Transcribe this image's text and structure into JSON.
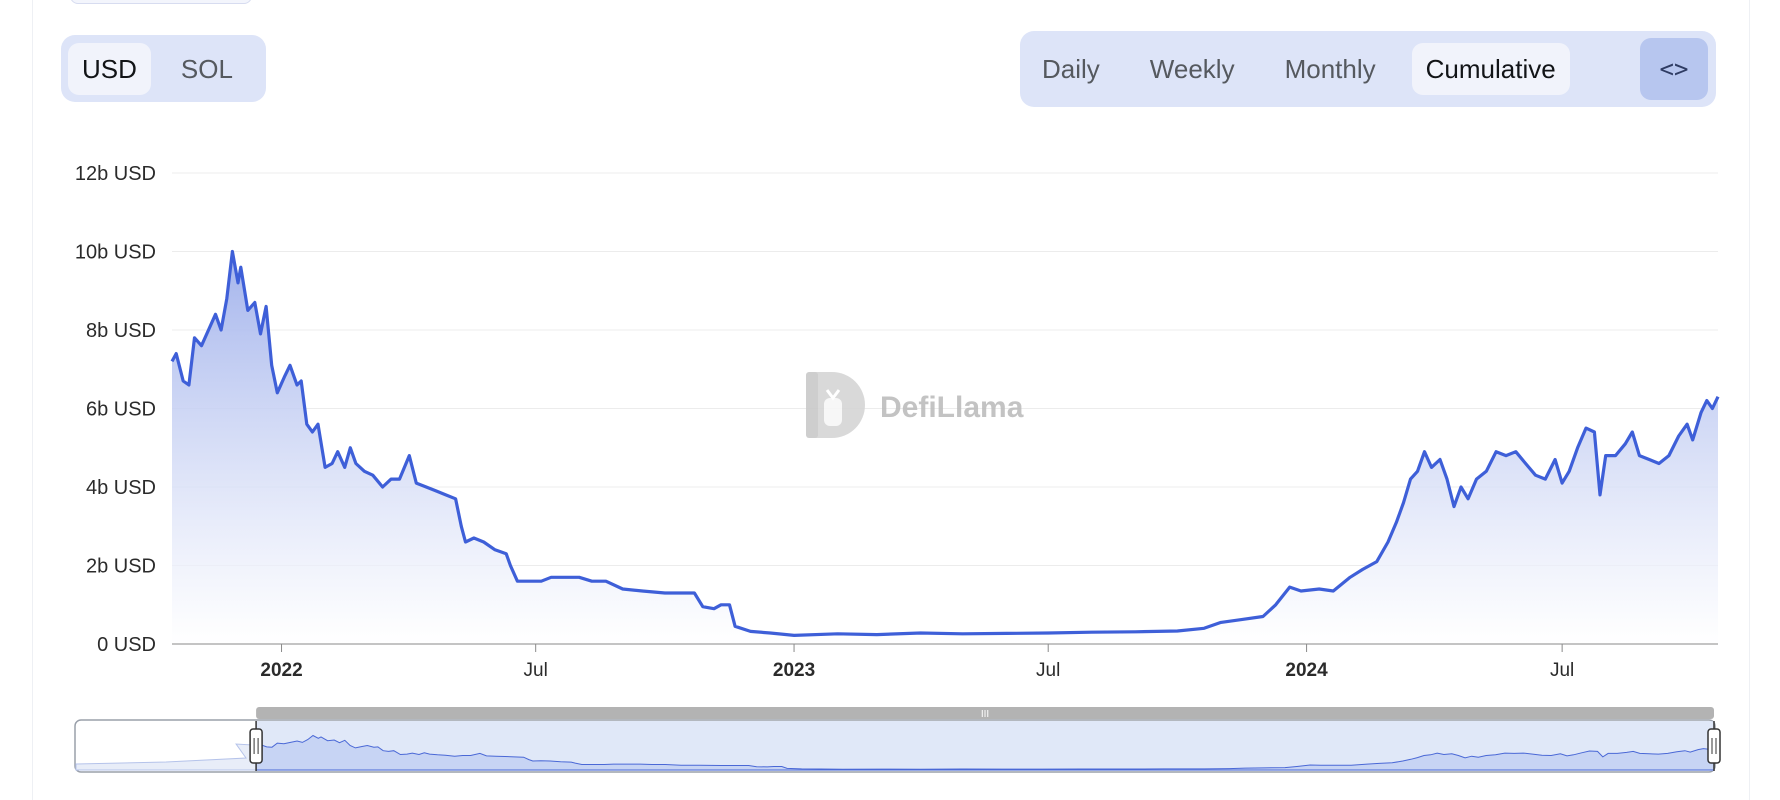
{
  "currency_toggle": {
    "options": [
      "USD",
      "SOL"
    ],
    "selected": "USD"
  },
  "range_toggle": {
    "options": [
      "Daily",
      "Weekly",
      "Monthly",
      "Cumulative"
    ],
    "selected": "Cumulative"
  },
  "embed_icon": "code-brackets-icon",
  "watermark": "DefiLlama",
  "colors": {
    "line": "#3e5fd8",
    "area_top": "#9fb0eb",
    "area_bottom": "#ffffff",
    "toggle_bg": "#dde4f8",
    "toggle_active": "#f1f3fb"
  },
  "chart_data": {
    "type": "area",
    "title": "",
    "xlabel": "",
    "ylabel": "",
    "x_range": [
      "2021-10-15",
      "2024-10-20"
    ],
    "ylim": [
      0,
      12
    ],
    "y_ticks": [
      {
        "value": 0,
        "label": "0 USD"
      },
      {
        "value": 2,
        "label": "2b USD"
      },
      {
        "value": 4,
        "label": "4b USD"
      },
      {
        "value": 6,
        "label": "6b USD"
      },
      {
        "value": 8,
        "label": "8b USD"
      },
      {
        "value": 10,
        "label": "10b USD"
      },
      {
        "value": 12,
        "label": "12b USD"
      }
    ],
    "x_ticks": [
      {
        "date": "2022-01-01",
        "label": "2022",
        "bold": true
      },
      {
        "date": "2022-07-01",
        "label": "Jul",
        "bold": false
      },
      {
        "date": "2023-01-01",
        "label": "2023",
        "bold": true
      },
      {
        "date": "2023-07-01",
        "label": "Jul",
        "bold": false
      },
      {
        "date": "2024-01-01",
        "label": "2024",
        "bold": true
      },
      {
        "date": "2024-07-01",
        "label": "Jul",
        "bold": false
      }
    ],
    "grid": true,
    "series": [
      {
        "values_unit": "billion USD",
        "points": [
          [
            "2021-10-15",
            7.2
          ],
          [
            "2021-10-18",
            7.4
          ],
          [
            "2021-10-23",
            6.7
          ],
          [
            "2021-10-27",
            6.6
          ],
          [
            "2021-10-31",
            7.8
          ],
          [
            "2021-11-05",
            7.6
          ],
          [
            "2021-11-10",
            8.0
          ],
          [
            "2021-11-15",
            8.4
          ],
          [
            "2021-11-19",
            8.0
          ],
          [
            "2021-11-23",
            8.8
          ],
          [
            "2021-11-27",
            10.0
          ],
          [
            "2021-12-01",
            9.2
          ],
          [
            "2021-12-03",
            9.6
          ],
          [
            "2021-12-08",
            8.5
          ],
          [
            "2021-12-13",
            8.7
          ],
          [
            "2021-12-17",
            7.9
          ],
          [
            "2021-12-21",
            8.6
          ],
          [
            "2021-12-25",
            7.1
          ],
          [
            "2021-12-29",
            6.4
          ],
          [
            "2022-01-03",
            6.8
          ],
          [
            "2022-01-07",
            7.1
          ],
          [
            "2022-01-12",
            6.6
          ],
          [
            "2022-01-15",
            6.7
          ],
          [
            "2022-01-19",
            5.6
          ],
          [
            "2022-01-23",
            5.4
          ],
          [
            "2022-01-27",
            5.6
          ],
          [
            "2022-02-01",
            4.5
          ],
          [
            "2022-02-06",
            4.6
          ],
          [
            "2022-02-10",
            4.9
          ],
          [
            "2022-02-15",
            4.5
          ],
          [
            "2022-02-19",
            5.0
          ],
          [
            "2022-02-23",
            4.6
          ],
          [
            "2022-03-01",
            4.4
          ],
          [
            "2022-03-07",
            4.3
          ],
          [
            "2022-03-14",
            4.0
          ],
          [
            "2022-03-20",
            4.2
          ],
          [
            "2022-03-26",
            4.2
          ],
          [
            "2022-04-02",
            4.8
          ],
          [
            "2022-04-07",
            4.1
          ],
          [
            "2022-04-14",
            4.0
          ],
          [
            "2022-04-21",
            3.9
          ],
          [
            "2022-04-28",
            3.8
          ],
          [
            "2022-05-05",
            3.7
          ],
          [
            "2022-05-09",
            3.0
          ],
          [
            "2022-05-12",
            2.6
          ],
          [
            "2022-05-18",
            2.7
          ],
          [
            "2022-05-25",
            2.6
          ],
          [
            "2022-06-02",
            2.4
          ],
          [
            "2022-06-10",
            2.3
          ],
          [
            "2022-06-13",
            2.0
          ],
          [
            "2022-06-18",
            1.6
          ],
          [
            "2022-06-25",
            1.6
          ],
          [
            "2022-07-05",
            1.6
          ],
          [
            "2022-07-12",
            1.7
          ],
          [
            "2022-07-20",
            1.7
          ],
          [
            "2022-08-01",
            1.7
          ],
          [
            "2022-08-10",
            1.6
          ],
          [
            "2022-08-20",
            1.6
          ],
          [
            "2022-09-01",
            1.4
          ],
          [
            "2022-09-15",
            1.35
          ],
          [
            "2022-10-01",
            1.3
          ],
          [
            "2022-10-15",
            1.3
          ],
          [
            "2022-10-22",
            1.3
          ],
          [
            "2022-10-28",
            0.95
          ],
          [
            "2022-11-05",
            0.9
          ],
          [
            "2022-11-10",
            1.0
          ],
          [
            "2022-11-16",
            1.0
          ],
          [
            "2022-11-20",
            0.45
          ],
          [
            "2022-12-01",
            0.32
          ],
          [
            "2022-12-15",
            0.28
          ],
          [
            "2023-01-01",
            0.22
          ],
          [
            "2023-02-01",
            0.26
          ],
          [
            "2023-03-01",
            0.24
          ],
          [
            "2023-04-01",
            0.28
          ],
          [
            "2023-05-01",
            0.26
          ],
          [
            "2023-06-01",
            0.27
          ],
          [
            "2023-07-01",
            0.28
          ],
          [
            "2023-08-01",
            0.3
          ],
          [
            "2023-09-01",
            0.31
          ],
          [
            "2023-10-01",
            0.33
          ],
          [
            "2023-10-20",
            0.4
          ],
          [
            "2023-11-01",
            0.55
          ],
          [
            "2023-11-15",
            0.62
          ],
          [
            "2023-12-01",
            0.7
          ],
          [
            "2023-12-10",
            1.0
          ],
          [
            "2023-12-20",
            1.45
          ],
          [
            "2023-12-28",
            1.35
          ],
          [
            "2024-01-10",
            1.4
          ],
          [
            "2024-01-20",
            1.35
          ],
          [
            "2024-02-01",
            1.7
          ],
          [
            "2024-02-10",
            1.9
          ],
          [
            "2024-02-20",
            2.1
          ],
          [
            "2024-02-28",
            2.6
          ],
          [
            "2024-03-05",
            3.1
          ],
          [
            "2024-03-10",
            3.6
          ],
          [
            "2024-03-15",
            4.2
          ],
          [
            "2024-03-20",
            4.4
          ],
          [
            "2024-03-25",
            4.9
          ],
          [
            "2024-03-30",
            4.5
          ],
          [
            "2024-04-05",
            4.7
          ],
          [
            "2024-04-10",
            4.2
          ],
          [
            "2024-04-15",
            3.5
          ],
          [
            "2024-04-20",
            4.0
          ],
          [
            "2024-04-25",
            3.7
          ],
          [
            "2024-05-01",
            4.2
          ],
          [
            "2024-05-08",
            4.4
          ],
          [
            "2024-05-15",
            4.9
          ],
          [
            "2024-05-22",
            4.8
          ],
          [
            "2024-05-29",
            4.9
          ],
          [
            "2024-06-05",
            4.6
          ],
          [
            "2024-06-12",
            4.3
          ],
          [
            "2024-06-19",
            4.2
          ],
          [
            "2024-06-26",
            4.7
          ],
          [
            "2024-07-01",
            4.1
          ],
          [
            "2024-07-06",
            4.4
          ],
          [
            "2024-07-12",
            5.0
          ],
          [
            "2024-07-18",
            5.5
          ],
          [
            "2024-07-24",
            5.4
          ],
          [
            "2024-07-28",
            3.8
          ],
          [
            "2024-08-01",
            4.8
          ],
          [
            "2024-08-08",
            4.8
          ],
          [
            "2024-08-15",
            5.1
          ],
          [
            "2024-08-20",
            5.4
          ],
          [
            "2024-08-25",
            4.8
          ],
          [
            "2024-09-01",
            4.7
          ],
          [
            "2024-09-08",
            4.6
          ],
          [
            "2024-09-15",
            4.8
          ],
          [
            "2024-09-22",
            5.3
          ],
          [
            "2024-09-28",
            5.6
          ],
          [
            "2024-10-02",
            5.2
          ],
          [
            "2024-10-08",
            5.9
          ],
          [
            "2024-10-12",
            6.2
          ],
          [
            "2024-10-16",
            6.0
          ],
          [
            "2024-10-20",
            6.3
          ]
        ]
      }
    ],
    "zoom_navigator": {
      "full_range_start": "2021-06-01",
      "selected_start": "2021-10-15",
      "selected_end": "2024-10-20"
    }
  }
}
